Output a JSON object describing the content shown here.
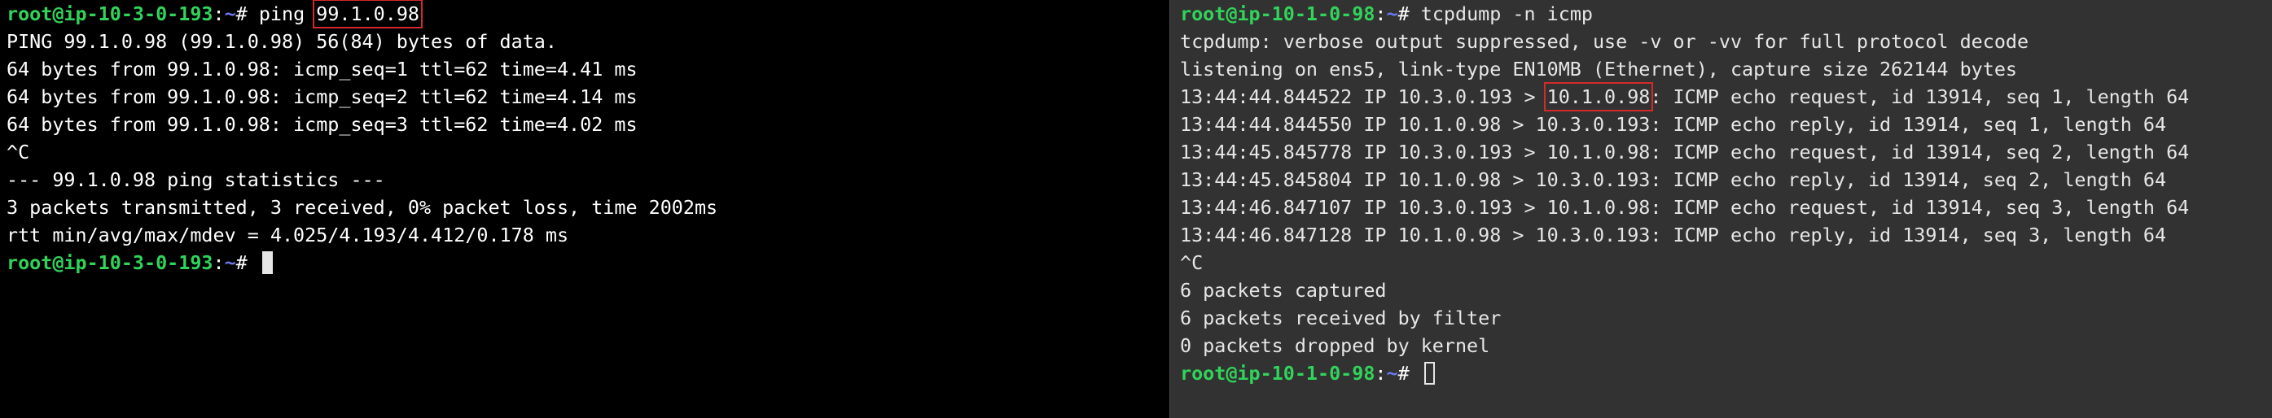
{
  "colors": {
    "left_background": "#000000",
    "right_background": "#323232",
    "prompt_user": "#31d35a",
    "prompt_path": "#6d79f5",
    "highlight_box": "#d62a2a"
  },
  "left_terminal": {
    "prompt_user": "root@ip-10-3-0-193",
    "prompt_sep": ":",
    "prompt_path": "~",
    "prompt_hash": "# ",
    "command_prefix": "ping ",
    "command_target": "99.1.0.98",
    "output": [
      "PING 99.1.0.98 (99.1.0.98) 56(84) bytes of data.",
      "64 bytes from 99.1.0.98: icmp_seq=1 ttl=62 time=4.41 ms",
      "64 bytes from 99.1.0.98: icmp_seq=2 ttl=62 time=4.14 ms",
      "64 bytes from 99.1.0.98: icmp_seq=3 ttl=62 time=4.02 ms",
      "^C",
      "--- 99.1.0.98 ping statistics ---",
      "3 packets transmitted, 3 received, 0% packet loss, time 2002ms",
      "rtt min/avg/max/mdev = 4.025/4.193/4.412/0.178 ms"
    ],
    "final_prompt_user": "root@ip-10-3-0-193",
    "final_prompt_sep": ":",
    "final_prompt_path": "~",
    "final_prompt_hash": "# "
  },
  "right_terminal": {
    "prompt_user": "root@ip-10-1-0-98",
    "prompt_sep": ":",
    "prompt_path": "~",
    "prompt_hash": "# ",
    "command": "tcpdump -n icmp",
    "header_lines": [
      "tcpdump: verbose output suppressed, use -v or -vv for full protocol decode",
      "listening on ens5, link-type EN10MB (Ethernet), capture size 262144 bytes"
    ],
    "first_packet": {
      "prefix": "13:44:44.844522 IP 10.3.0.193 > ",
      "highlighted": "10.1.0.98",
      "suffix": ": ICMP echo request, id 13914, seq 1, length 64"
    },
    "packets": [
      "13:44:44.844550 IP 10.1.0.98 > 10.3.0.193: ICMP echo reply, id 13914, seq 1, length 64",
      "13:44:45.845778 IP 10.3.0.193 > 10.1.0.98: ICMP echo request, id 13914, seq 2, length 64",
      "13:44:45.845804 IP 10.1.0.98 > 10.3.0.193: ICMP echo reply, id 13914, seq 2, length 64",
      "13:44:46.847107 IP 10.3.0.193 > 10.1.0.98: ICMP echo request, id 13914, seq 3, length 64",
      "13:44:46.847128 IP 10.1.0.98 > 10.3.0.193: ICMP echo reply, id 13914, seq 3, length 64"
    ],
    "footer_lines": [
      "^C",
      "6 packets captured",
      "6 packets received by filter",
      "0 packets dropped by kernel"
    ],
    "final_prompt_user": "root@ip-10-1-0-98",
    "final_prompt_sep": ":",
    "final_prompt_path": "~",
    "final_prompt_hash": "# "
  }
}
